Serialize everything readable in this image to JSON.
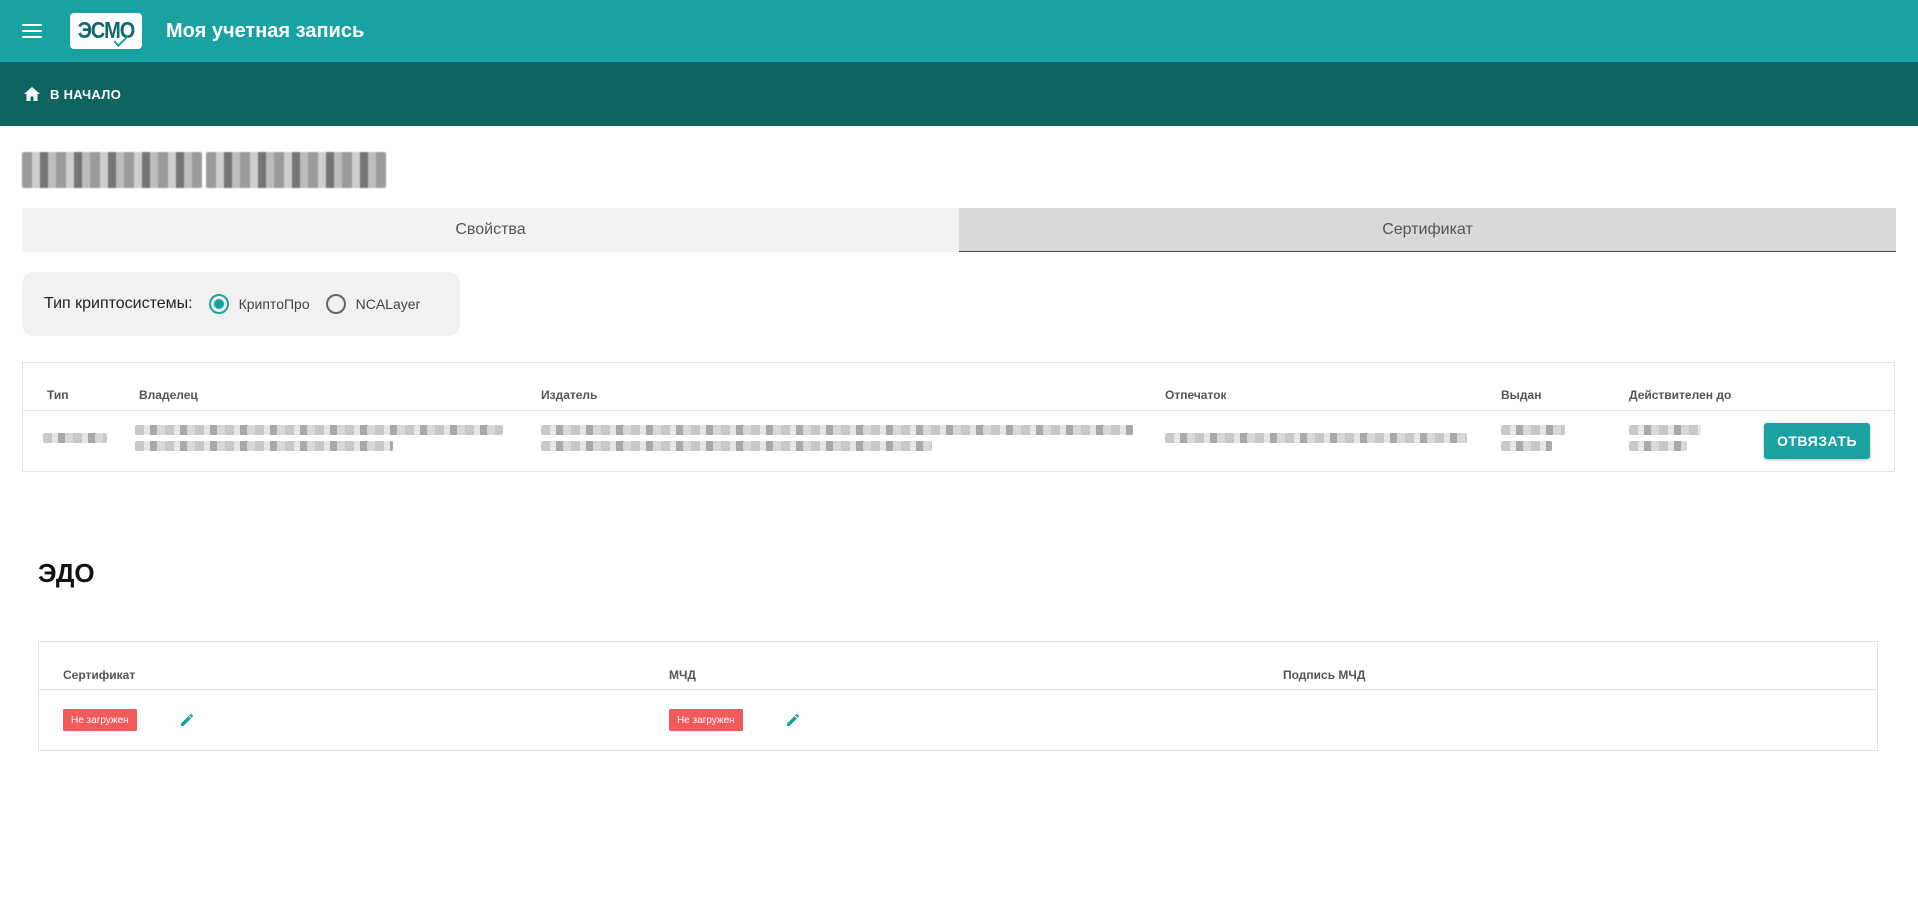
{
  "header": {
    "app_title": "Моя учетная запись",
    "logo_text": "ЭСМО",
    "accent_color": "#18a2a2"
  },
  "nav": {
    "home_label": "В НАЧАЛО"
  },
  "tabs": [
    {
      "label": "Свойства",
      "active": false
    },
    {
      "label": "Сертификат",
      "active": true
    }
  ],
  "crypto": {
    "label": "Тип криптосистемы:",
    "options": [
      {
        "label": "КриптоПро",
        "checked": true
      },
      {
        "label": "NCALayer",
        "checked": false
      }
    ]
  },
  "cert_table": {
    "columns": [
      "Тип",
      "Владелец",
      "Издатель",
      "Отпечаток",
      "Выдан",
      "Действителен до"
    ],
    "action_label": "ОТВЯЗАТЬ"
  },
  "edo": {
    "title": "ЭДО",
    "columns": [
      "Сертификат",
      "МЧД",
      "Подпись МЧД"
    ],
    "cert_status": "Не загружен",
    "mchd_status": "Не загружен",
    "status_color": "#f05a5a"
  },
  "icons": [
    "menu-icon",
    "home-icon",
    "edit-icon"
  ]
}
